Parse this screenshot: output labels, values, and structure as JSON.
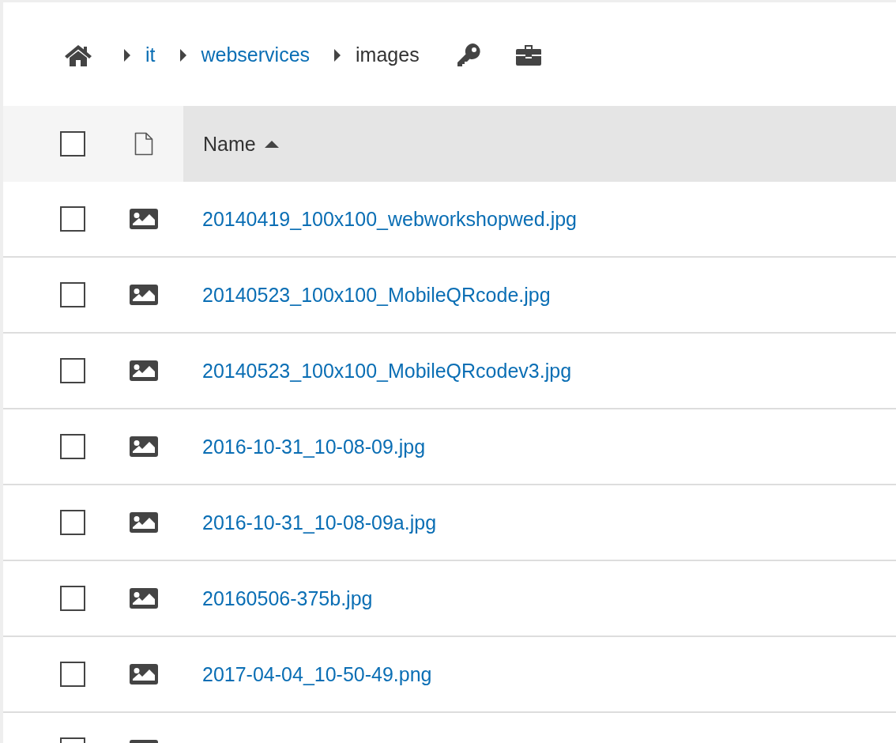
{
  "breadcrumb": [
    {
      "label": "it",
      "kind": "link"
    },
    {
      "label": "webservices",
      "kind": "link"
    },
    {
      "label": "images",
      "kind": "current"
    }
  ],
  "table": {
    "select_all": {
      "checked": false
    },
    "columns": [
      {
        "label": "Name",
        "sort_ascending": true
      }
    ],
    "rows": [
      {
        "name": "20140419_100x100_webworkshopwed.jpg",
        "checked": false
      },
      {
        "name": "20140523_100x100_MobileQRcode.jpg",
        "checked": false
      },
      {
        "name": "20140523_100x100_MobileQRcodev3.jpg",
        "checked": false
      },
      {
        "name": "2016-10-31_10-08-09.jpg",
        "checked": false
      },
      {
        "name": "2016-10-31_10-08-09a.jpg",
        "checked": false
      },
      {
        "name": "20160506-375b.jpg",
        "checked": false
      },
      {
        "name": "2017-04-04_10-50-49.png",
        "checked": false
      },
      {
        "checked": false
      }
    ]
  }
}
